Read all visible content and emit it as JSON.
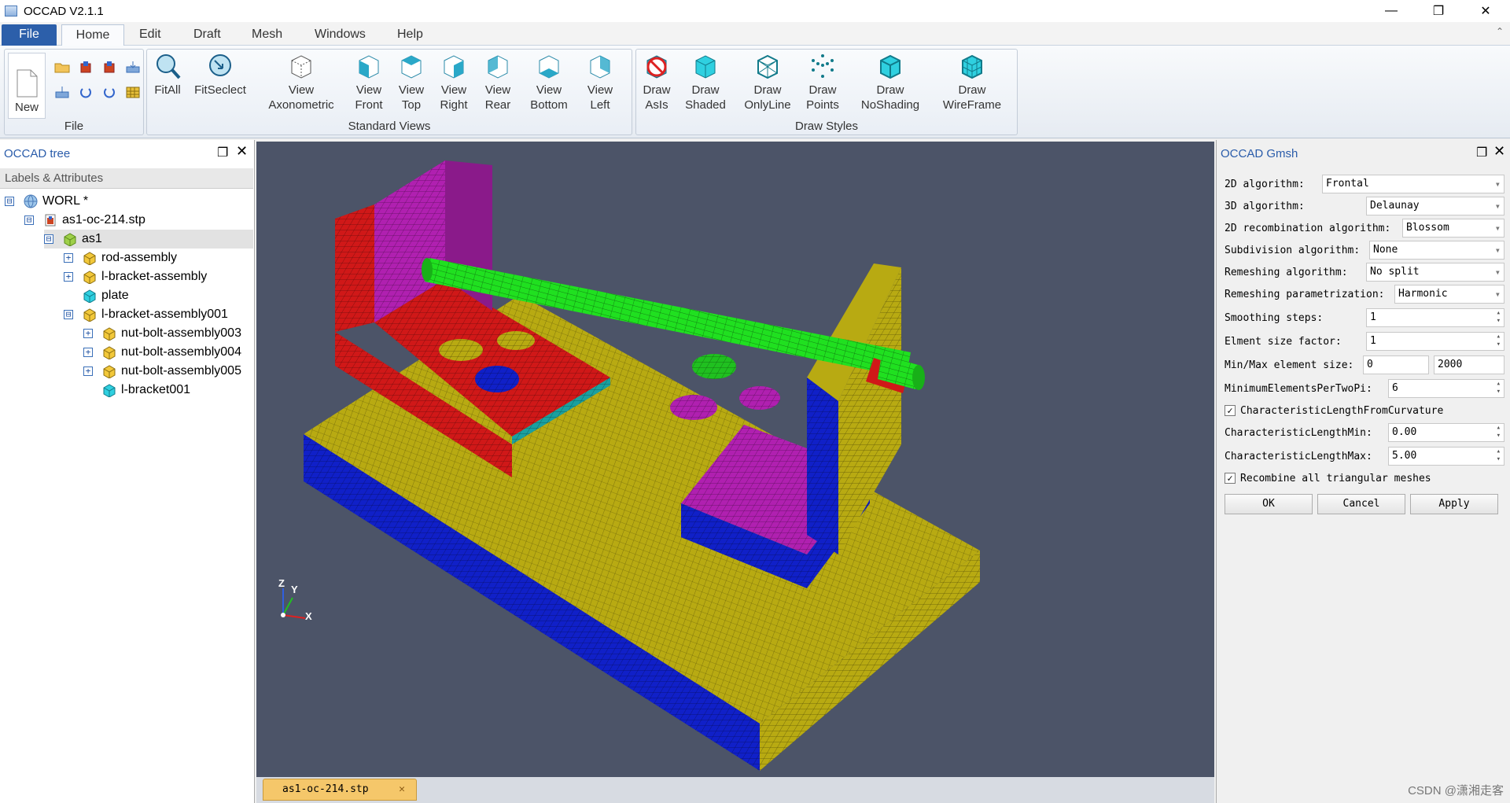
{
  "app": {
    "title": "OCCAD V2.1.1"
  },
  "menu": {
    "file": "File",
    "home": "Home",
    "edit": "Edit",
    "draft": "Draft",
    "mesh": "Mesh",
    "windows": "Windows",
    "help": "Help"
  },
  "ribbon": {
    "file_group": {
      "label": "File",
      "new": "New"
    },
    "views_group": {
      "label": "Standard Views",
      "fitall": "FitAll",
      "fitselect": "FitSeclect",
      "axon_1": "View",
      "axon_2": "Axonometric",
      "front_1": "View",
      "front_2": "Front",
      "top_1": "View",
      "top_2": "Top",
      "right_1": "View",
      "right_2": "Right",
      "rear_1": "View",
      "rear_2": "Rear",
      "bottom_1": "View",
      "bottom_2": "Bottom",
      "left_1": "View",
      "left_2": "Left"
    },
    "styles_group": {
      "label": "Draw Styles",
      "asis_1": "Draw",
      "asis_2": "AsIs",
      "shaded_1": "Draw",
      "shaded_2": "Shaded",
      "onlyline_1": "Draw",
      "onlyline_2": "OnlyLine",
      "points_1": "Draw",
      "points_2": "Points",
      "noshading_1": "Draw",
      "noshading_2": "NoShading",
      "wireframe_1": "Draw",
      "wireframe_2": "WireFrame"
    }
  },
  "tree": {
    "title": "OCCAD tree",
    "header": "Labels & Attributes",
    "items": [
      {
        "label": "WORL *",
        "expander": "⊟"
      },
      {
        "label": "as1-oc-214.stp",
        "expander": "⊟"
      },
      {
        "label": "as1",
        "expander": "⊟"
      },
      {
        "label": "rod-assembly",
        "expander": "+"
      },
      {
        "label": "l-bracket-assembly",
        "expander": "+"
      },
      {
        "label": "plate",
        "expander": ""
      },
      {
        "label": "l-bracket-assembly001",
        "expander": "⊟"
      },
      {
        "label": "nut-bolt-assembly003",
        "expander": "+"
      },
      {
        "label": "nut-bolt-assembly004",
        "expander": "+"
      },
      {
        "label": "nut-bolt-assembly005",
        "expander": "+"
      },
      {
        "label": "l-bracket001",
        "expander": ""
      }
    ]
  },
  "viewport": {
    "axis_x": "X",
    "axis_y": "Y",
    "axis_z": "Z"
  },
  "doc_tab": {
    "label": "as1-oc-214.stp"
  },
  "gmsh": {
    "title": "OCCAD Gmsh",
    "alg2d_label": "2D algorithm:",
    "alg2d_value": "Frontal",
    "alg3d_label": "3D algorithm:",
    "alg3d_value": "Delaunay",
    "recomb_label": "2D recombination algorithm:",
    "recomb_value": "Blossom",
    "subdiv_label": "Subdivision algorithm:",
    "subdiv_value": "None",
    "remesh_label": "Remeshing algorithm:",
    "remesh_value": "No split",
    "remeshparam_label": "Remeshing parametrization:",
    "remeshparam_value": "Harmonic",
    "smooth_label": "Smoothing steps:",
    "smooth_value": "1",
    "sizefactor_label": "Elment size factor:",
    "sizefactor_value": "1",
    "minmax_label": "Min/Max element size:",
    "min_value": "0",
    "max_value": "2000",
    "mept_label": "MinimumElementsPerTwoPi:",
    "mept_value": "6",
    "clfc_label": "CharacteristicLengthFromCurvature",
    "clmin_label": "CharacteristicLengthMin:",
    "clmin_value": "0.00",
    "clmax_label": "CharacteristicLengthMax:",
    "clmax_value": "5.00",
    "recomb_all_label": "Recombine all triangular meshes",
    "ok": "OK",
    "cancel": "Cancel",
    "apply": "Apply"
  },
  "watermark": "CSDN @潇湘走客"
}
